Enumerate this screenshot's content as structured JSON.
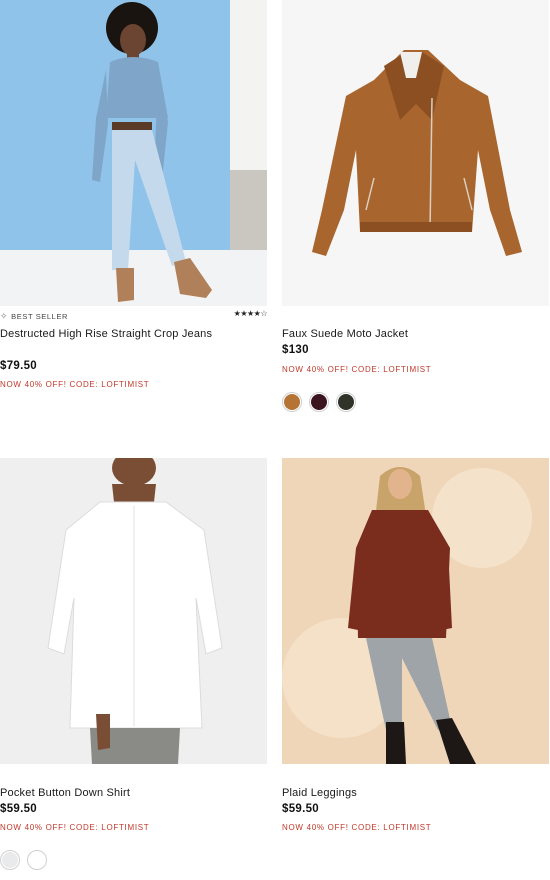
{
  "products": [
    {
      "badge": "BEST SELLER",
      "rating": "★★★★☆",
      "name": "Destructed High Rise Straight Crop Jeans",
      "price": "$79.50",
      "promo": "NOW 40% OFF! CODE: LOFTIMIST",
      "swatches": []
    },
    {
      "name": "Faux Suede Moto Jacket",
      "price": "$130",
      "promo": "NOW 40% OFF! CODE: LOFTIMIST",
      "swatches": [
        "#b57436",
        "#3b1420",
        "#2f3328"
      ]
    },
    {
      "name": "Pocket Button Down Shirt",
      "price": "$59.50",
      "promo": "NOW 40% OFF! CODE: LOFTIMIST",
      "swatches": [
        "#e8eaec",
        "#ffffff"
      ]
    },
    {
      "name": "Plaid Leggings",
      "price": "$59.50",
      "promo": "NOW 40% OFF! CODE: LOFTIMIST",
      "swatches": []
    }
  ]
}
